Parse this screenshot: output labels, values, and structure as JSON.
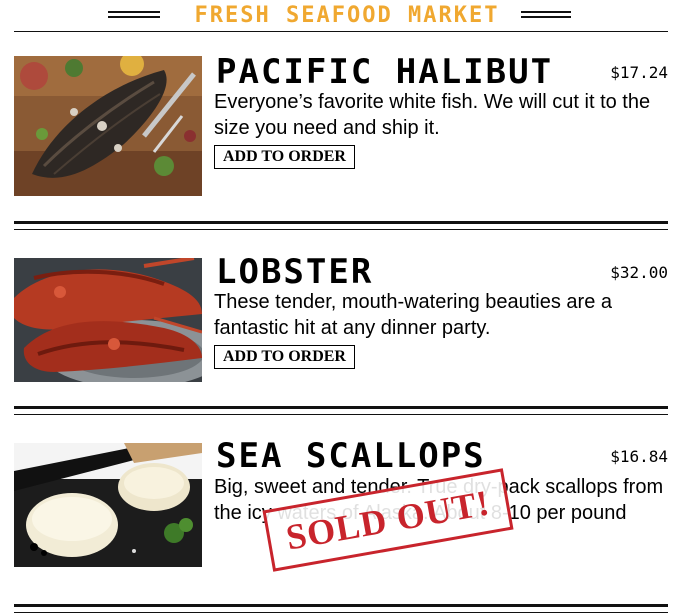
{
  "header": {
    "title": "FRESH SEAFOOD MARKET"
  },
  "items": [
    {
      "name": "PACIFIC HALIBUT",
      "price": "$17.24",
      "description": "Everyone’s favorite white fish. We will cut it to the size you need and ship it.",
      "button_label": "ADD TO ORDER",
      "image": "grilled-fish-photo"
    },
    {
      "name": "LOBSTER",
      "price": "$32.00",
      "description": "These tender, mouth-watering beauties are a fantastic hit at any dinner party.",
      "button_label": "ADD TO ORDER",
      "image": "lobster-photo"
    },
    {
      "name": "SEA SCALLOPS",
      "price": "$16.84",
      "description": "Big, sweet and tender. True dry-pack scallops from the icy waters of Alaska. About 8-10 per pound",
      "stamp": "SOLD OUT!",
      "image": "scallops-photo"
    }
  ],
  "colors": {
    "accent": "#f0a830",
    "stamp": "#c8242c",
    "rule": "#111111"
  }
}
